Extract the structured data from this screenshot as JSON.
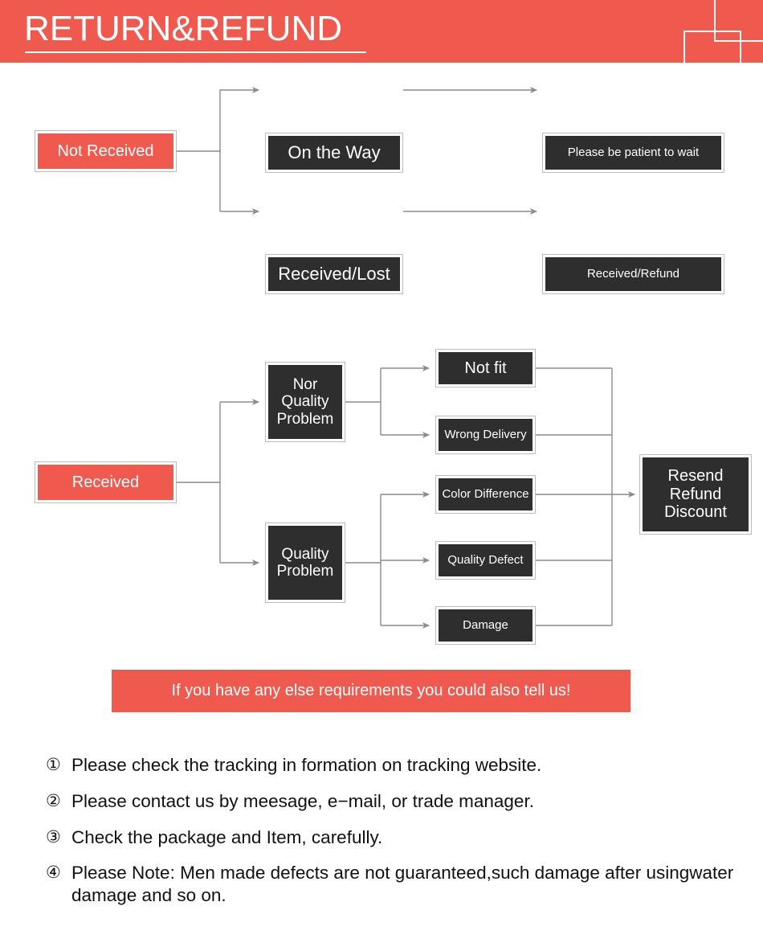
{
  "header": {
    "title": "RETURN&REFUND",
    "brand_color": "#f05a4e"
  },
  "diagram": {
    "branch_not_received": {
      "root": "Not Received",
      "steps": [
        {
          "stage": "On the Way",
          "outcome": "Please be patient to wait"
        },
        {
          "stage": "Received/Lost",
          "outcome": "Received/Refund"
        }
      ]
    },
    "branch_received": {
      "root": "Received",
      "groups": [
        {
          "label": "Nor Quality Problem",
          "reasons": [
            "Not fit",
            "Wrong Delivery"
          ]
        },
        {
          "label": "Quality Problem",
          "reasons": [
            "Color Difference",
            "Quality Defect",
            "Damage"
          ]
        }
      ],
      "resolution": "Resend Refund Discount",
      "resolution_lines": [
        "Resend",
        "Refund",
        "Discount"
      ]
    },
    "node_fill": "#2e2e2e",
    "node_border": "#bdbdbd",
    "wire_color": "#8c8c8c"
  },
  "callout": {
    "text": "If you have any else requirements you could also tell us!"
  },
  "notes": [
    {
      "num": "①",
      "text": "Please check the tracking in formation on tracking website."
    },
    {
      "num": "②",
      "text": "Please contact us by meesage, e−mail, or trade manager."
    },
    {
      "num": "③",
      "text": "Check the package and Item, carefully."
    },
    {
      "num": "④",
      "text": "Please Note: Men made defects are not guaranteed,such damage after usingwater damage and so on."
    }
  ]
}
